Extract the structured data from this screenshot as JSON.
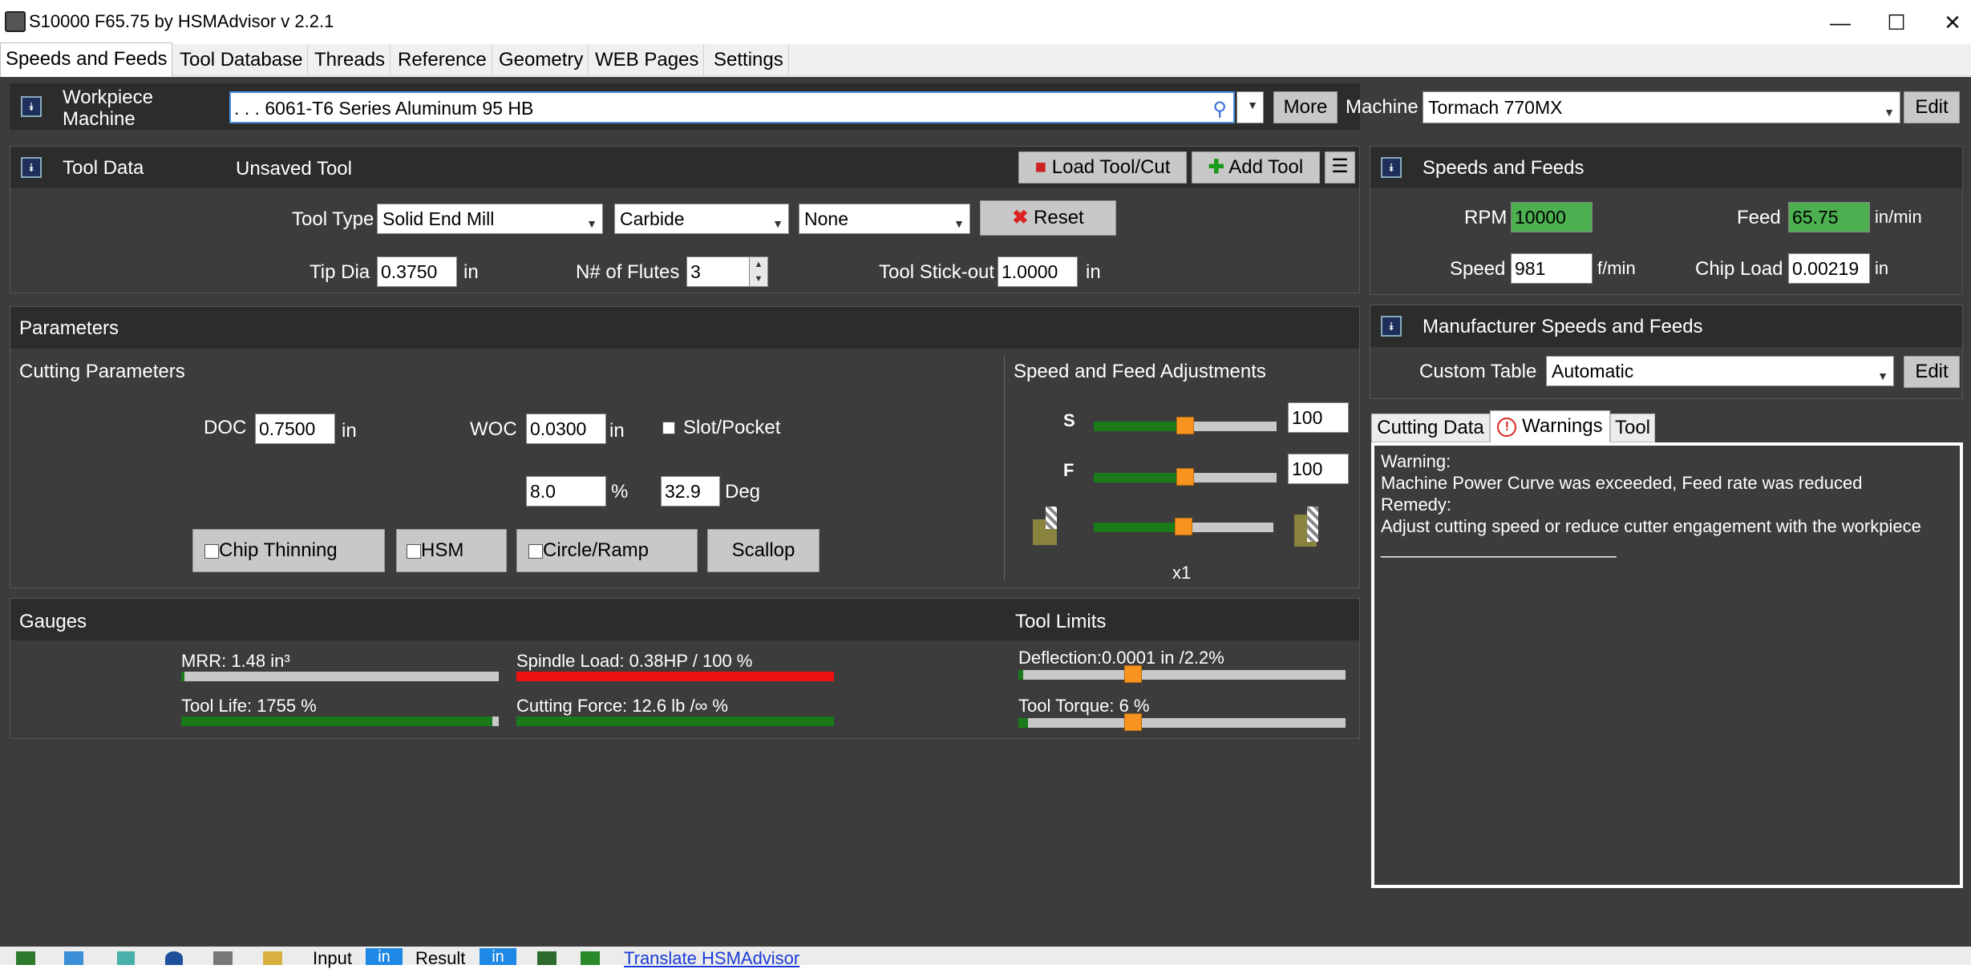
{
  "window": {
    "title": "S10000 F65.75 by HSMAdvisor v 2.2.1",
    "min": "—",
    "max": "☐",
    "close": "✕"
  },
  "tabs": [
    "Speeds and Feeds",
    "Tool Database",
    "Threads",
    "Reference",
    "Geometry",
    "WEB Pages",
    "Settings"
  ],
  "workpiece": {
    "label1": "Workpiece",
    "label2": "Machine",
    "material": ". . . 6061-T6 Series Aluminum 95 HB",
    "more_btn": "More",
    "machine_label": "Machine",
    "machine": "Tormach 770MX",
    "edit_btn": "Edit"
  },
  "tool_data": {
    "title": "Tool Data",
    "status": "Unsaved Tool",
    "load_btn": "Load Tool/Cut",
    "add_btn": "Add Tool",
    "tool_type_label": "Tool Type",
    "tool_type": "Solid End Mill",
    "material": "Carbide",
    "coating": "None",
    "reset_btn": "Reset",
    "tip_dia_label": "Tip Dia",
    "tip_dia": "0.3750",
    "tip_dia_unit": "in",
    "flutes_label": "N# of Flutes",
    "flutes": "3",
    "stickout_label": "Tool Stick-out",
    "stickout": "1.0000",
    "stickout_unit": "in"
  },
  "parameters": {
    "title": "Parameters",
    "cutting_title": "Cutting Parameters",
    "doc_label": "DOC",
    "doc": "0.7500",
    "doc_unit": "in",
    "woc_label": "WOC",
    "woc": "0.0300",
    "woc_unit": "in",
    "slot_label": "Slot/Pocket",
    "woc_pct": "8.0",
    "pct_unit": "%",
    "angle": "32.9",
    "angle_unit": "Deg",
    "chip_thinning": "Chip Thinning",
    "hsm": "HSM",
    "circle_ramp": "Circle/Ramp",
    "scallop": "Scallop",
    "adj_title": "Speed and Feed Adjustments",
    "s_label": "S",
    "s_value": "100",
    "s_level": 0.5,
    "f_label": "F",
    "f_value": "100",
    "f_level": 0.5,
    "tool_level": 0.5,
    "multiplier": "x1"
  },
  "gauges": {
    "title": "Gauges",
    "limits_title": "Tool Limits",
    "mrr": "MRR: 1.48 in³",
    "mrr_level": 0.01,
    "spindle": "Spindle Load: 0.38HP / 100 %",
    "spindle_level": 1.0,
    "life": "Tool Life: 1755 %",
    "life_level": 0.98,
    "force": "Cutting Force: 12.6 lb /∞ %",
    "force_level": 1.0,
    "deflection": "Deflection:0.0001 in /2.2%",
    "deflection_level": 0.35,
    "torque": "Tool Torque: 6 %",
    "torque_level": 0.35
  },
  "speeds_feeds": {
    "title": "Speeds and Feeds",
    "rpm_label": "RPM",
    "rpm": "10000",
    "feed_label": "Feed",
    "feed": "65.75",
    "feed_unit": "in/min",
    "speed_label": "Speed",
    "speed": "981",
    "speed_unit": "f/min",
    "chipload_label": "Chip Load",
    "chipload": "0.00219",
    "chipload_unit": "in"
  },
  "manufacturer": {
    "title": "Manufacturer Speeds and Feeds",
    "table_label": "Custom Table",
    "table": "Automatic",
    "edit_btn": "Edit"
  },
  "result_tabs": [
    "Cutting Data",
    "Warnings",
    "Tool"
  ],
  "warning": {
    "l1": "Warning:",
    "l2": "Machine Power Curve was exceeded, Feed rate was reduced",
    "l3": "Remedy:",
    "l4": "Adjust cutting speed or reduce cutter engagement with the workpiece",
    "l5": "________________________"
  },
  "bottom": {
    "input_label": "Input",
    "input_unit": "in",
    "result_label": "Result",
    "result_unit": "in",
    "translate": "Translate HSMAdvisor"
  },
  "colors": {
    "green": "#4caf50",
    "red": "#e11",
    "orange": "#f7931e",
    "bar_green": "#1a7a1a"
  }
}
